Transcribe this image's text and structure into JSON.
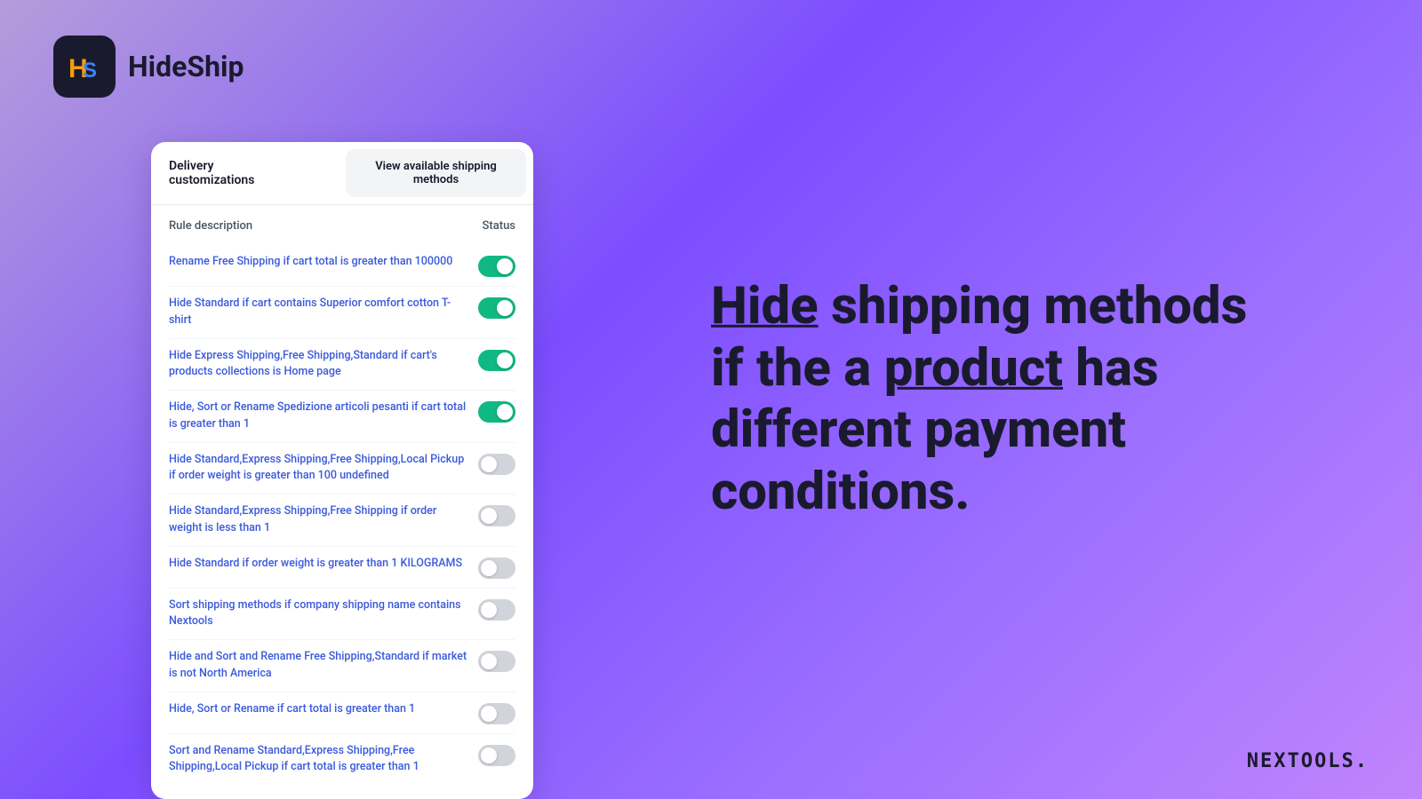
{
  "logo": {
    "icon_text": "HS",
    "app_name": "HideShip"
  },
  "panel": {
    "tab_delivery": "Delivery\ncustomizations",
    "tab_view": "View available shipping\nmethods",
    "col_rule_desc": "Rule description",
    "col_status": "Status",
    "rules": [
      {
        "label": "Rename Free Shipping if cart total is greater than 100000",
        "enabled": true
      },
      {
        "label": "Hide Standard if cart contains Superior comfort cotton T-shirt",
        "enabled": true
      },
      {
        "label": "Hide Express Shipping,Free Shipping,Standard if cart's products collections is Home page",
        "enabled": true
      },
      {
        "label": "Hide, Sort or Rename Spedizione articoli pesanti if cart total is greater than 1",
        "enabled": true
      },
      {
        "label": "Hide Standard,Express Shipping,Free Shipping,Local Pickup if order weight is greater than 100 undefined",
        "enabled": false
      },
      {
        "label": "Hide Standard,Express Shipping,Free Shipping if order weight is less than 1",
        "enabled": false
      },
      {
        "label": "Hide Standard if order weight is greater than 1 KILOGRAMS",
        "enabled": false
      },
      {
        "label": "Sort shipping methods if company shipping name contains Nextools",
        "enabled": false
      },
      {
        "label": "Hide and Sort and Rename Free Shipping,Standard if market is not North America",
        "enabled": false
      },
      {
        "label": "Hide, Sort or Rename if cart total is greater than 1",
        "enabled": false
      },
      {
        "label": "Sort and Rename Standard,Express Shipping,Free Shipping,Local Pickup if cart total is greater than 1",
        "enabled": false
      }
    ]
  },
  "hero": {
    "line1": "Hide shipping methods",
    "line2": "if the a product has",
    "line3": "different payment conditions.",
    "underline_word1": "Hide",
    "underline_word2": "product"
  },
  "footer": {
    "nextools": "NEXTOOLS."
  }
}
